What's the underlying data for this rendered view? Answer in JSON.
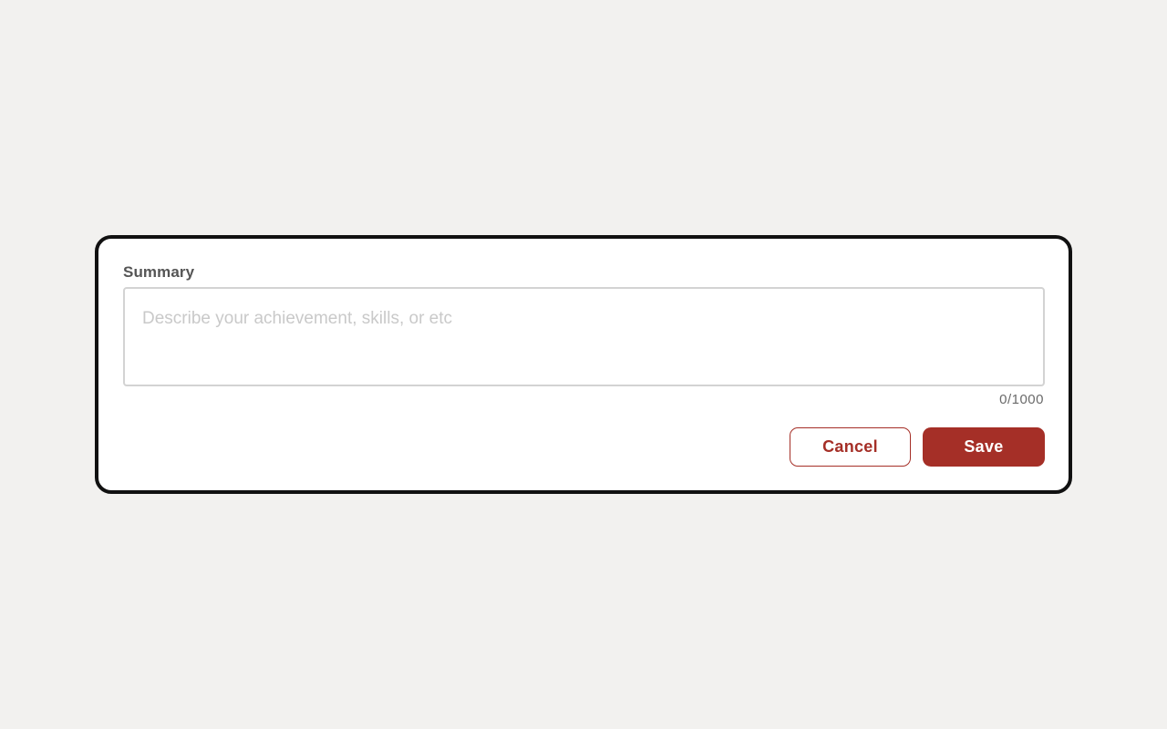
{
  "form": {
    "summary_label": "Summary",
    "summary_value": "",
    "summary_placeholder": "Describe your achievement, skills, or etc",
    "char_counter": "0/1000"
  },
  "actions": {
    "cancel_label": "Cancel",
    "save_label": "Save"
  },
  "colors": {
    "background": "#f2f1ef",
    "accent": "#a52f27",
    "card_border": "#111111",
    "label_text": "#555555",
    "placeholder_text": "#c9c9c9"
  }
}
